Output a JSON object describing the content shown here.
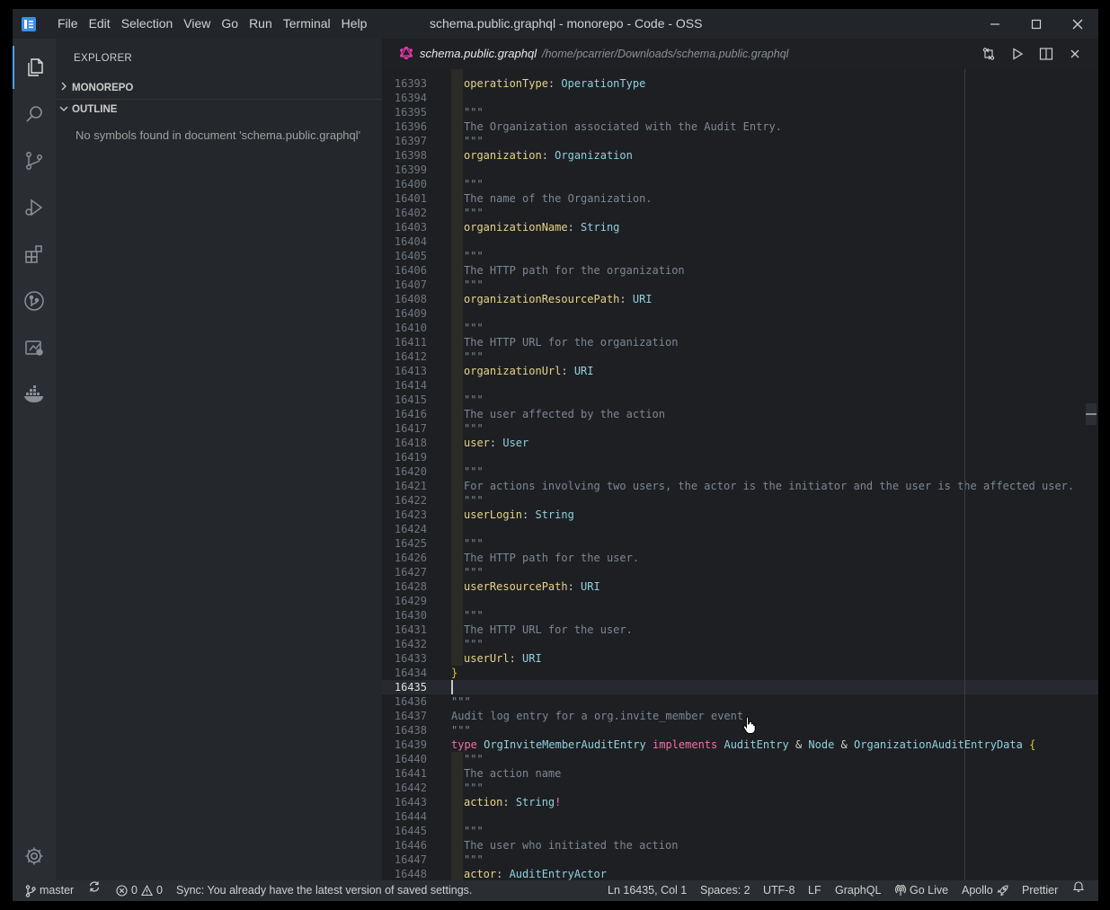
{
  "window": {
    "title": "schema.public.graphql - monorepo - Code - OSS",
    "menu": [
      "File",
      "Edit",
      "Selection",
      "View",
      "Go",
      "Run",
      "Terminal",
      "Help"
    ]
  },
  "sidebar": {
    "title": "EXPLORER",
    "sections": [
      {
        "label": "MONOREPO",
        "expanded": false
      },
      {
        "label": "OUTLINE",
        "expanded": true
      }
    ],
    "outline_message": "No symbols found in document 'schema.public.graphql'"
  },
  "tab": {
    "name": "schema.public.graphql",
    "path": "/home/pcarrier/Downloads/schema.public.graphql"
  },
  "editor": {
    "current_line": "16435",
    "lines": [
      {
        "n": "16393",
        "t": [
          [
            "operationType",
            "field"
          ],
          [
            ": ",
            "punc"
          ],
          [
            "OperationType",
            "type"
          ]
        ],
        "g": true
      },
      {
        "n": "16394",
        "t": [],
        "g": true
      },
      {
        "n": "16395",
        "t": [
          [
            "\"\"\"",
            "com"
          ]
        ],
        "g": true
      },
      {
        "n": "16396",
        "t": [
          [
            "The Organization associated with the Audit Entry.",
            "com"
          ]
        ],
        "g": true
      },
      {
        "n": "16397",
        "t": [
          [
            "\"\"\"",
            "com"
          ]
        ],
        "g": true
      },
      {
        "n": "16398",
        "t": [
          [
            "organization",
            "field"
          ],
          [
            ": ",
            "punc"
          ],
          [
            "Organization",
            "type"
          ]
        ],
        "g": true
      },
      {
        "n": "16399",
        "t": [],
        "g": true
      },
      {
        "n": "16400",
        "t": [
          [
            "\"\"\"",
            "com"
          ]
        ],
        "g": true
      },
      {
        "n": "16401",
        "t": [
          [
            "The name of the Organization.",
            "com"
          ]
        ],
        "g": true
      },
      {
        "n": "16402",
        "t": [
          [
            "\"\"\"",
            "com"
          ]
        ],
        "g": true
      },
      {
        "n": "16403",
        "t": [
          [
            "organizationName",
            "field"
          ],
          [
            ": ",
            "punc"
          ],
          [
            "String",
            "type"
          ]
        ],
        "g": true
      },
      {
        "n": "16404",
        "t": [],
        "g": true
      },
      {
        "n": "16405",
        "t": [
          [
            "\"\"\"",
            "com"
          ]
        ],
        "g": true
      },
      {
        "n": "16406",
        "t": [
          [
            "The HTTP path for the organization",
            "com"
          ]
        ],
        "g": true
      },
      {
        "n": "16407",
        "t": [
          [
            "\"\"\"",
            "com"
          ]
        ],
        "g": true
      },
      {
        "n": "16408",
        "t": [
          [
            "organizationResourcePath",
            "field"
          ],
          [
            ": ",
            "punc"
          ],
          [
            "URI",
            "type"
          ]
        ],
        "g": true
      },
      {
        "n": "16409",
        "t": [],
        "g": true
      },
      {
        "n": "16410",
        "t": [
          [
            "\"\"\"",
            "com"
          ]
        ],
        "g": true
      },
      {
        "n": "16411",
        "t": [
          [
            "The HTTP URL for the organization",
            "com"
          ]
        ],
        "g": true
      },
      {
        "n": "16412",
        "t": [
          [
            "\"\"\"",
            "com"
          ]
        ],
        "g": true
      },
      {
        "n": "16413",
        "t": [
          [
            "organizationUrl",
            "field"
          ],
          [
            ": ",
            "punc"
          ],
          [
            "URI",
            "type"
          ]
        ],
        "g": true
      },
      {
        "n": "16414",
        "t": [],
        "g": true
      },
      {
        "n": "16415",
        "t": [
          [
            "\"\"\"",
            "com"
          ]
        ],
        "g": true
      },
      {
        "n": "16416",
        "t": [
          [
            "The user affected by the action",
            "com"
          ]
        ],
        "g": true
      },
      {
        "n": "16417",
        "t": [
          [
            "\"\"\"",
            "com"
          ]
        ],
        "g": true
      },
      {
        "n": "16418",
        "t": [
          [
            "user",
            "field"
          ],
          [
            ": ",
            "punc"
          ],
          [
            "User",
            "type"
          ]
        ],
        "g": true
      },
      {
        "n": "16419",
        "t": [],
        "g": true
      },
      {
        "n": "16420",
        "t": [
          [
            "\"\"\"",
            "com"
          ]
        ],
        "g": true
      },
      {
        "n": "16421",
        "t": [
          [
            "For actions involving two users, the actor is the initiator and the user is the affected user.",
            "com"
          ]
        ],
        "g": true
      },
      {
        "n": "16422",
        "t": [
          [
            "\"\"\"",
            "com"
          ]
        ],
        "g": true
      },
      {
        "n": "16423",
        "t": [
          [
            "userLogin",
            "field"
          ],
          [
            ": ",
            "punc"
          ],
          [
            "String",
            "type"
          ]
        ],
        "g": true
      },
      {
        "n": "16424",
        "t": [],
        "g": true
      },
      {
        "n": "16425",
        "t": [
          [
            "\"\"\"",
            "com"
          ]
        ],
        "g": true
      },
      {
        "n": "16426",
        "t": [
          [
            "The HTTP path for the user.",
            "com"
          ]
        ],
        "g": true
      },
      {
        "n": "16427",
        "t": [
          [
            "\"\"\"",
            "com"
          ]
        ],
        "g": true
      },
      {
        "n": "16428",
        "t": [
          [
            "userResourcePath",
            "field"
          ],
          [
            ": ",
            "punc"
          ],
          [
            "URI",
            "type"
          ]
        ],
        "g": true
      },
      {
        "n": "16429",
        "t": [],
        "g": true
      },
      {
        "n": "16430",
        "t": [
          [
            "\"\"\"",
            "com"
          ]
        ],
        "g": true
      },
      {
        "n": "16431",
        "t": [
          [
            "The HTTP URL for the user.",
            "com"
          ]
        ],
        "g": true
      },
      {
        "n": "16432",
        "t": [
          [
            "\"\"\"",
            "com"
          ]
        ],
        "g": true
      },
      {
        "n": "16433",
        "t": [
          [
            "userUrl",
            "field"
          ],
          [
            ": ",
            "punc"
          ],
          [
            "URI",
            "type"
          ]
        ],
        "g": true
      },
      {
        "n": "16434",
        "t": [
          [
            "}",
            "brace"
          ]
        ],
        "g": false
      },
      {
        "n": "16435",
        "t": [],
        "g": false,
        "cur": true
      },
      {
        "n": "16436",
        "t": [
          [
            "\"\"\"",
            "com"
          ]
        ],
        "g": false
      },
      {
        "n": "16437",
        "t": [
          [
            "Audit log entry for a org.invite_member event.",
            "com"
          ]
        ],
        "g": false
      },
      {
        "n": "16438",
        "t": [
          [
            "\"\"\"",
            "com"
          ]
        ],
        "g": false
      },
      {
        "n": "16439",
        "t": [
          [
            "type",
            "kw"
          ],
          [
            " ",
            "punc"
          ],
          [
            "OrgInviteMemberAuditEntry",
            "type"
          ],
          [
            " ",
            "punc"
          ],
          [
            "implements",
            "kw"
          ],
          [
            " ",
            "punc"
          ],
          [
            "AuditEntry",
            "type"
          ],
          [
            " & ",
            "punc"
          ],
          [
            "Node",
            "type"
          ],
          [
            " & ",
            "punc"
          ],
          [
            "OrganizationAuditEntryData",
            "type"
          ],
          [
            " ",
            "punc"
          ],
          [
            "{",
            "brace"
          ]
        ],
        "g": false
      },
      {
        "n": "16440",
        "t": [
          [
            "\"\"\"",
            "com"
          ]
        ],
        "g": true
      },
      {
        "n": "16441",
        "t": [
          [
            "The action name",
            "com"
          ]
        ],
        "g": true
      },
      {
        "n": "16442",
        "t": [
          [
            "\"\"\"",
            "com"
          ]
        ],
        "g": true
      },
      {
        "n": "16443",
        "t": [
          [
            "action",
            "field"
          ],
          [
            ": ",
            "punc"
          ],
          [
            "String",
            "type"
          ],
          [
            "!",
            "bang"
          ]
        ],
        "g": true
      },
      {
        "n": "16444",
        "t": [],
        "g": true
      },
      {
        "n": "16445",
        "t": [
          [
            "\"\"\"",
            "com"
          ]
        ],
        "g": true
      },
      {
        "n": "16446",
        "t": [
          [
            "The user who initiated the action",
            "com"
          ]
        ],
        "g": true
      },
      {
        "n": "16447",
        "t": [
          [
            "\"\"\"",
            "com"
          ]
        ],
        "g": true
      },
      {
        "n": "16448",
        "t": [
          [
            "actor",
            "field"
          ],
          [
            ": ",
            "punc"
          ],
          [
            "AuditEntryActor",
            "type"
          ]
        ],
        "g": true
      }
    ]
  },
  "status": {
    "branch": "master",
    "errors": "0",
    "warnings": "0",
    "sync_message": "Sync: You already have the latest version of saved settings.",
    "position": "Ln 16435, Col 1",
    "spaces": "Spaces: 2",
    "encoding": "UTF-8",
    "eol": "LF",
    "language": "GraphQL",
    "go_live": "Go Live",
    "apollo": "Apollo",
    "prettier": "Prettier"
  },
  "colors": {
    "accent": "#4aa3ff",
    "graphql_pink": "#e535ab"
  }
}
